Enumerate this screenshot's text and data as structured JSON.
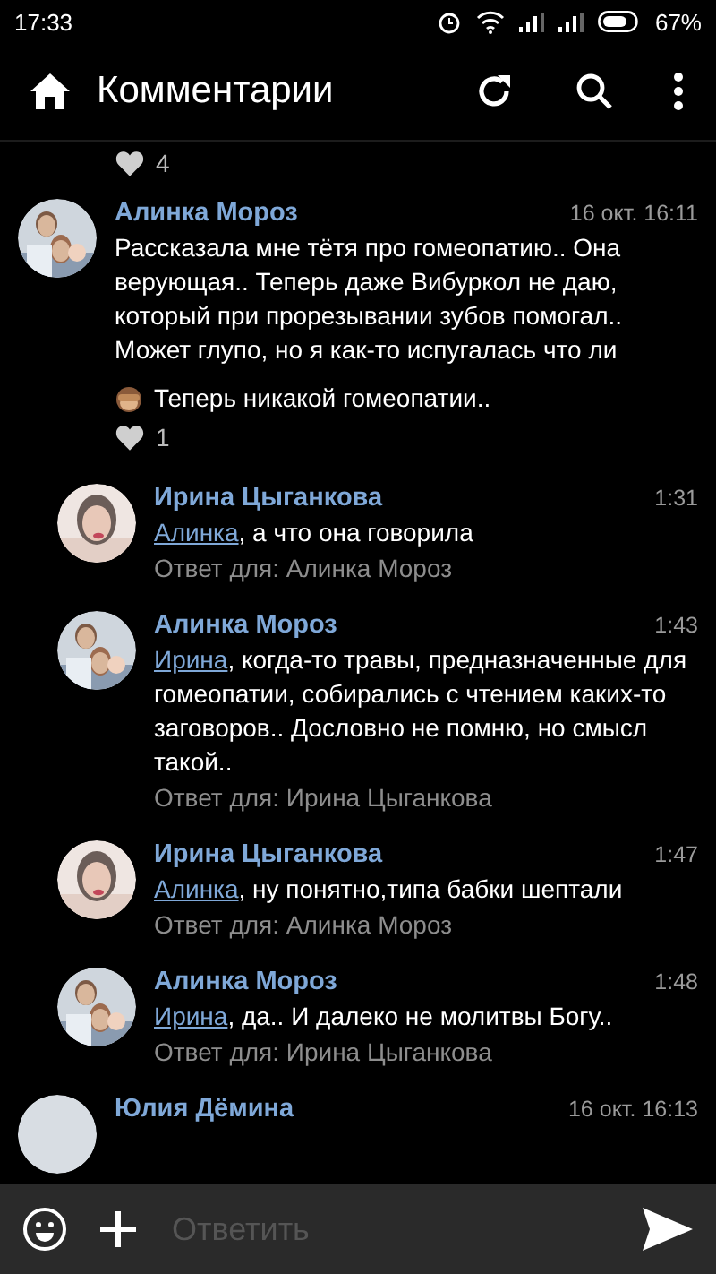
{
  "status_bar": {
    "time": "17:33",
    "battery": "67%"
  },
  "header": {
    "title": "Комментарии"
  },
  "previous_likes": "4",
  "comments": [
    {
      "author": "Алинка Мороз",
      "time": "16 окт. 16:11",
      "reply": false,
      "text": "Рассказала мне тётя про гомеопатию.. Она верующая.. Теперь даже Вибуркол не даю, который при прорезывании зубов помогал.. Может глупо, но я как-то испугалась что ли",
      "extra": "Теперь никакой гомеопатии..",
      "likes": "1"
    },
    {
      "author": "Ирина Цыганкова",
      "time": "1:31",
      "reply": true,
      "mention": "Алинка",
      "text": ", а что она говорила",
      "reply_to": "Ответ для: Алинка Мороз"
    },
    {
      "author": "Алинка Мороз",
      "time": "1:43",
      "reply": true,
      "mention": "Ирина",
      "text": ", когда-то травы, предназначенные для гомеопатии, собирались с чтением каких-то заговоров.. Дословно не помню, но смысл такой..",
      "reply_to": "Ответ для: Ирина Цыганкова"
    },
    {
      "author": "Ирина Цыганкова",
      "time": "1:47",
      "reply": true,
      "mention": "Алинка",
      "text": ", ну понятно,типа бабки шептали",
      "reply_to": "Ответ для: Алинка Мороз"
    },
    {
      "author": "Алинка Мороз",
      "time": "1:48",
      "reply": true,
      "mention": "Ирина",
      "text": ", да.. И далеко не молитвы Богу..",
      "reply_to": "Ответ для: Ирина Цыганкова"
    },
    {
      "author": "Юлия Дёмина",
      "time": "16 окт. 16:13",
      "reply": false
    }
  ],
  "composer": {
    "placeholder": "Ответить"
  }
}
